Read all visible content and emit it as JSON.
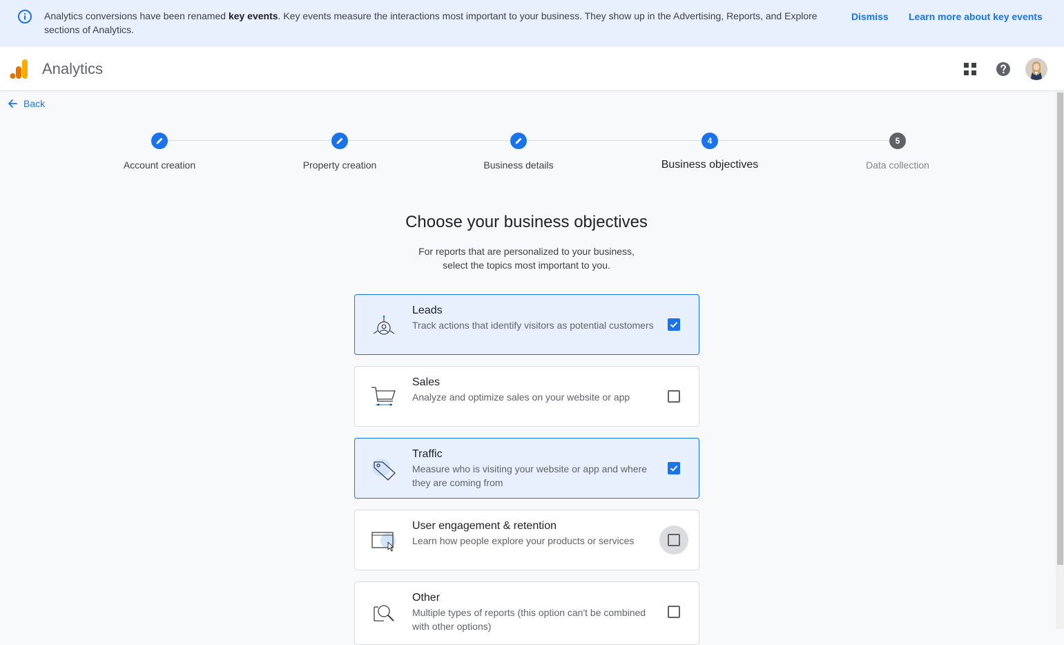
{
  "banner": {
    "text_before": "Analytics conversions have been renamed ",
    "text_bold": "key events",
    "text_after": ". Key events measure the interactions most important to your business. They show up in the Advertising, Reports, and Explore sections of Analytics.",
    "dismiss_label": "Dismiss",
    "learn_more_label": "Learn more about key events",
    "icon": "info-icon"
  },
  "header": {
    "app_title": "Analytics",
    "apps_icon": "apps-grid-icon",
    "help_icon": "help-icon"
  },
  "nav": {
    "back_label": "Back"
  },
  "stepper": {
    "steps": [
      {
        "label": "Account creation",
        "state": "done"
      },
      {
        "label": "Property creation",
        "state": "done"
      },
      {
        "label": "Business details",
        "state": "done"
      },
      {
        "label": "Business objectives",
        "state": "active",
        "number": "4"
      },
      {
        "label": "Data collection",
        "state": "pending",
        "number": "5"
      }
    ]
  },
  "main": {
    "title": "Choose your business objectives",
    "subtitle_line1": "For reports that are personalized to your business,",
    "subtitle_line2": "select the topics most important to you."
  },
  "objectives": [
    {
      "title": "Leads",
      "description": "Track actions that identify visitors as potential customers",
      "checked": true,
      "icon": "leads-icon"
    },
    {
      "title": "Sales",
      "description": "Analyze and optimize sales on your website or app",
      "checked": false,
      "icon": "shopping-cart-icon"
    },
    {
      "title": "Traffic",
      "description": "Measure who is visiting your website or app and where they are coming from",
      "checked": true,
      "icon": "tag-icon"
    },
    {
      "title": "User engagement & retention",
      "description": "Learn how people explore your products or services",
      "checked": false,
      "icon": "browser-cursor-icon"
    },
    {
      "title": "Other",
      "description": "Multiple types of reports (this option can't be combined with other options)",
      "checked": false,
      "icon": "magnifier-icon"
    }
  ],
  "colors": {
    "accent": "#1a73e8",
    "banner_bg": "#e8f0fe",
    "selected_card_bg": "#e8f0fe",
    "logo_orange": "#f9ab00",
    "logo_dark_orange": "#e37400"
  }
}
